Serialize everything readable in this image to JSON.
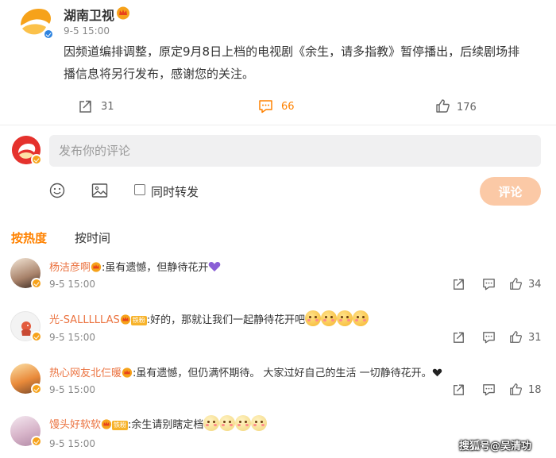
{
  "post": {
    "author": "湖南卫视",
    "time": "9-5 15:00",
    "text_line1": "因频道编排调整，原定9月8日上档的电视剧《余生，请多指教》暂停播出，后续剧场排",
    "text_line2": "播信息将另行发布，感谢您的关注。",
    "reposts": "31",
    "comments": "66",
    "likes": "176",
    "accent": "#ff8200"
  },
  "composer": {
    "placeholder": "发布你的评论",
    "repost_label": "同时转发",
    "submit_label": "评论"
  },
  "sort_tabs": {
    "hot": "按热度",
    "time": "按时间"
  },
  "comments": [
    {
      "user": "杨洁彦啊",
      "text": ":虽有遗憾，但静待花开",
      "time": "9-5 15:00",
      "likes": "34"
    },
    {
      "user": "光-SALLLLLAS",
      "badge": "铁粉",
      "text": ":好的，那就让我们一起静待花开吧",
      "time": "9-5 15:00",
      "likes": "31"
    },
    {
      "user": "热心网友北仨暖",
      "text": ":虽有遗憾，但仍满怀期待。 大家过好自己的生活 一切静待花开。",
      "time": "9-5 15:00",
      "likes": "18"
    },
    {
      "user": "馒头好软软",
      "badge": "铁粉",
      "text": ":余生请别瞎定档",
      "time": "9-5 15:00"
    }
  ],
  "watermark": "搜狐号@吴清功"
}
